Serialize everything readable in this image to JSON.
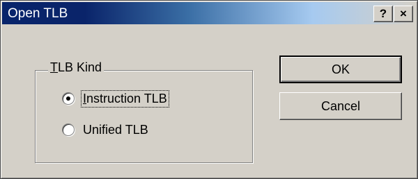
{
  "window": {
    "title": "Open TLB",
    "help_glyph": "?",
    "close_glyph": "×"
  },
  "group": {
    "label_mnemonic": "T",
    "label_rest": "LB Kind",
    "options": [
      {
        "mnemonic": "I",
        "rest": "nstruction TLB",
        "selected": true
      },
      {
        "mnemonic": "",
        "rest": "Unified TLB",
        "selected": false
      }
    ]
  },
  "buttons": {
    "ok_label": "OK",
    "cancel_label": "Cancel"
  },
  "colors": {
    "face": "#d4d0c8",
    "title_active": "#0a246a"
  }
}
